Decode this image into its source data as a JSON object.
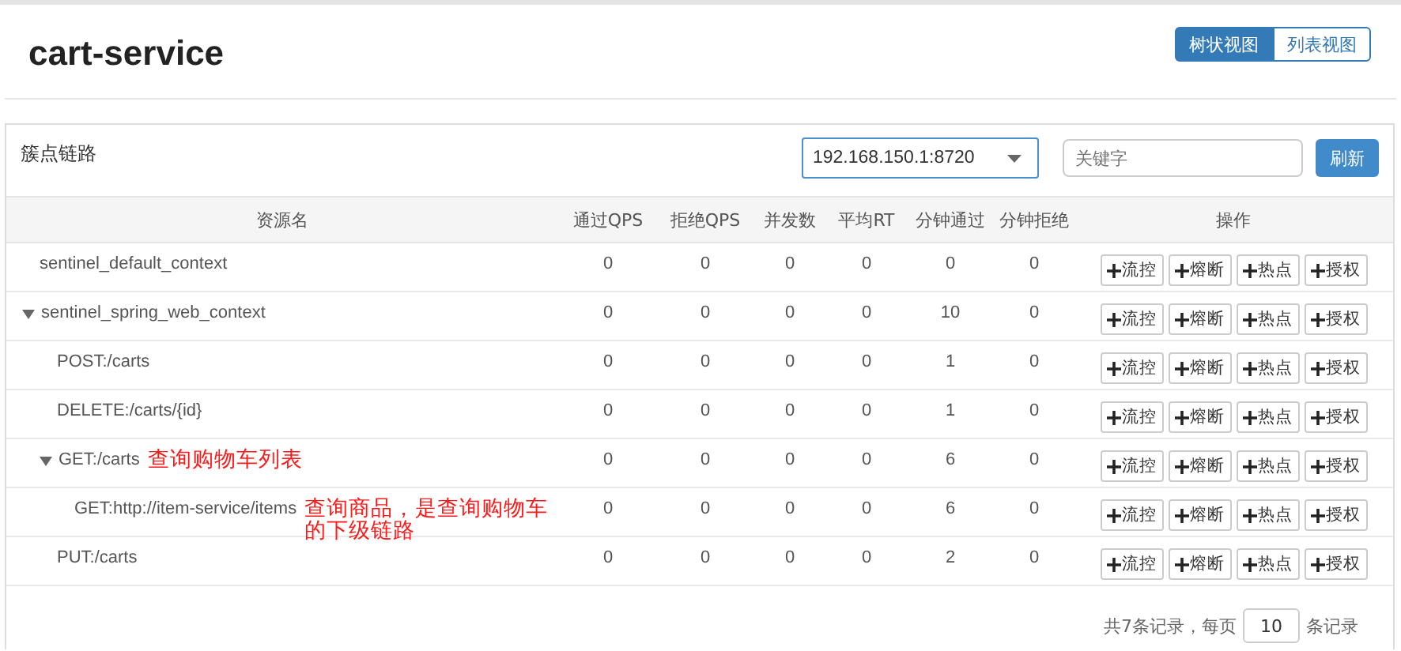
{
  "title": "cart-service",
  "view_tabs": [
    {
      "label": "树状视图",
      "selected": true
    },
    {
      "label": "列表视图",
      "selected": false
    }
  ],
  "panel": {
    "title": "簇点链路",
    "machine": "192.168.150.1:8720",
    "search": {
      "placeholder": "关键字"
    },
    "refresh": "刷新"
  },
  "columns": [
    "资源名",
    "通过QPS",
    "拒绝QPS",
    "并发数",
    "平均RT",
    "分钟通过",
    "分钟拒绝",
    "操作"
  ],
  "rows": [
    {
      "name": "sentinel_default_context",
      "values": [
        "0",
        "0",
        "0",
        "0",
        "0",
        "0"
      ],
      "actions": [
        "流控",
        "熔断",
        "热点",
        "授权"
      ]
    },
    {
      "name": "sentinel_spring_web_context",
      "expanded": true,
      "values": [
        "0",
        "0",
        "0",
        "0",
        "10",
        "0"
      ],
      "actions": [
        "流控",
        "熔断",
        "热点",
        "授权"
      ],
      "children": [
        {
          "name": "POST:/carts",
          "values": [
            "0",
            "0",
            "0",
            "0",
            "1",
            "0"
          ],
          "actions": [
            "流控",
            "熔断",
            "热点",
            "授权"
          ]
        },
        {
          "name": "DELETE:/carts/{id}",
          "values": [
            "0",
            "0",
            "0",
            "0",
            "1",
            "0"
          ],
          "actions": [
            "流控",
            "熔断",
            "热点",
            "授权"
          ]
        },
        {
          "name": "GET:/carts",
          "expanded": true,
          "note": "查询购物车列表",
          "values": [
            "0",
            "0",
            "0",
            "0",
            "6",
            "0"
          ],
          "actions": [
            "流控",
            "熔断",
            "热点",
            "授权"
          ],
          "children": [
            {
              "name": "GET:http://item-service/items",
              "note": "查询商品，是查询购物车的下级链路",
              "values": [
                "0",
                "0",
                "0",
                "0",
                "6",
                "0"
              ],
              "actions": [
                "流控",
                "熔断",
                "热点",
                "授权"
              ]
            }
          ]
        },
        {
          "name": "PUT:/carts",
          "values": [
            "0",
            "0",
            "0",
            "0",
            "2",
            "0"
          ],
          "actions": [
            "流控",
            "熔断",
            "热点",
            "授权"
          ]
        }
      ]
    }
  ],
  "pagination": {
    "summary": "共7条记录，每页",
    "page_size": "10",
    "unit": "条记录"
  }
}
